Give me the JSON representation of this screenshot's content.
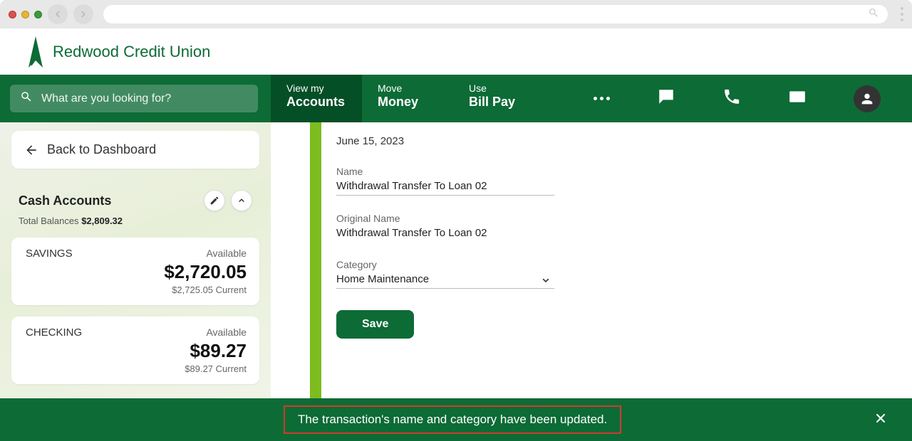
{
  "brand": {
    "name": "Redwood Credit Union"
  },
  "search": {
    "placeholder": "What are you looking for?"
  },
  "nav_tabs": [
    {
      "line1": "View my",
      "line2": "Accounts"
    },
    {
      "line1": "Move",
      "line2": "Money"
    },
    {
      "line1": "Use",
      "line2": "Bill Pay"
    }
  ],
  "sidebar": {
    "back_label": "Back to Dashboard",
    "section_title": "Cash Accounts",
    "total_label": "Total Balances",
    "total_value": "$2,809.32",
    "accounts": [
      {
        "name": "SAVINGS",
        "available_label": "Available",
        "balance": "$2,720.05",
        "current": "$2,725.05 Current"
      },
      {
        "name": "CHECKING",
        "available_label": "Available",
        "balance": "$89.27",
        "current": "$89.27 Current"
      }
    ]
  },
  "form": {
    "date": "June 15, 2023",
    "name_label": "Name",
    "name_value": "Withdrawal Transfer To Loan 02",
    "original_label": "Original Name",
    "original_value": "Withdrawal Transfer To Loan 02",
    "category_label": "Category",
    "category_value": "Home Maintenance",
    "save_label": "Save"
  },
  "toast": {
    "message": "The transaction's name and category have been updated."
  }
}
